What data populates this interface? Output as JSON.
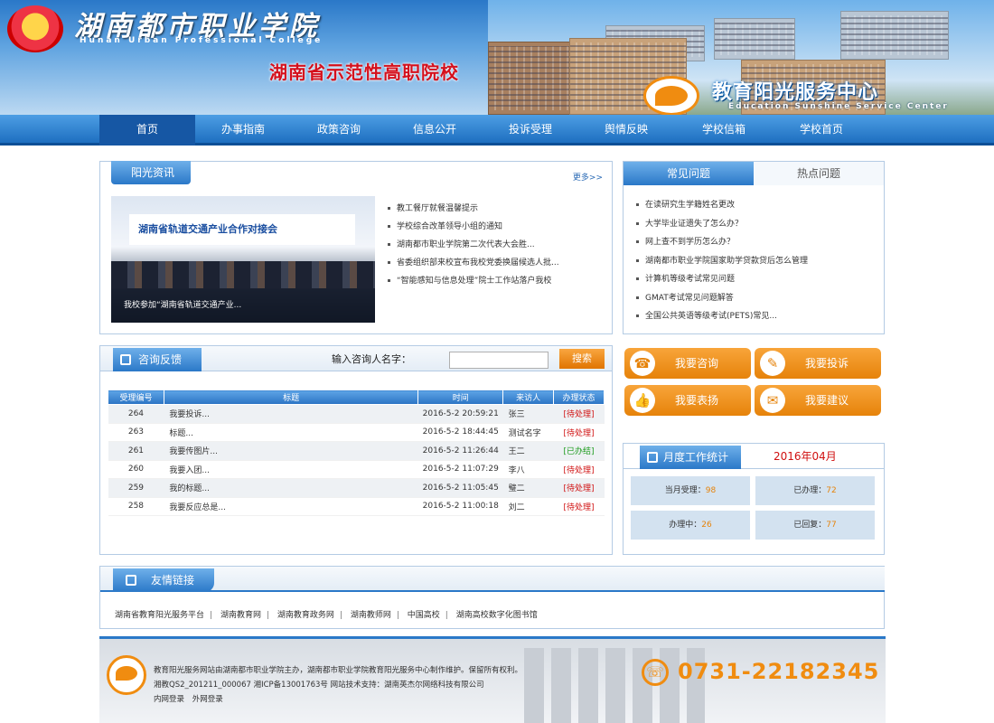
{
  "header": {
    "school_name": "湖南都市职业学院",
    "school_name_en": "Hunan Urban Professional College",
    "slogan": "湖南省示范性高职院校",
    "center_name": "教育阳光服务中心",
    "center_name_en": "Education Sunshine Service Center"
  },
  "nav": {
    "items": [
      "首页",
      "办事指南",
      "政策咨询",
      "信息公开",
      "投诉受理",
      "舆情反映",
      "学校信箱",
      "学校首页"
    ],
    "active_index": 0
  },
  "news": {
    "title": "阳光资讯",
    "more": "更多>>",
    "image_banner": "湖南省轨道交通产业合作对接会",
    "image_caption": "我校参加“湖南省轨道交通产业...",
    "items": [
      "教工餐厅就餐温馨提示",
      "学校综合改革领导小组的通知",
      "湖南都市职业学院第二次代表大会胜...",
      "省委组织部来校宣布我校党委换届候选人批...",
      "“智能感知与信息处理”院士工作站落户我校"
    ]
  },
  "faq": {
    "tabs": [
      "常见问题",
      "热点问题"
    ],
    "items": [
      "在读研究生学籍姓名更改",
      "大学毕业证遗失了怎么办？",
      "网上查不到学历怎么办？",
      "湖南都市职业学院国家助学贷款贷后怎么管理",
      "计算机等级考试常见问题",
      "GMAT考试常见问题解答",
      "全国公共英语等级考试(PETS)常见..."
    ]
  },
  "consult": {
    "title": "咨询反馈",
    "search_label": "输入咨询人名字：",
    "search_value": "",
    "search_button": "搜索",
    "columns": [
      "受理编号",
      "标题",
      "时间",
      "来访人",
      "办理状态"
    ],
    "rows": [
      {
        "id": "264",
        "title": "我要投诉...",
        "time": "2016-5-2 20:59:21",
        "person": "张三",
        "status": "[待处理]",
        "done": false
      },
      {
        "id": "263",
        "title": "标题...",
        "time": "2016-5-2 18:44:45",
        "person": "测试名字",
        "status": "[待处理]",
        "done": false
      },
      {
        "id": "261",
        "title": "我要传图片...",
        "time": "2016-5-2 11:26:44",
        "person": "王二",
        "status": "[已办结]",
        "done": true
      },
      {
        "id": "260",
        "title": "我要入团...",
        "time": "2016-5-2 11:07:29",
        "person": "李八",
        "status": "[待处理]",
        "done": false
      },
      {
        "id": "259",
        "title": "我的标题...",
        "time": "2016-5-2 11:05:45",
        "person": "璧二",
        "status": "[待处理]",
        "done": false
      },
      {
        "id": "258",
        "title": "我要反应总是...",
        "time": "2016-5-2 11:00:18",
        "person": "刘二",
        "status": "[待处理]",
        "done": false
      }
    ]
  },
  "actions": [
    {
      "label": "我要咨询",
      "icon": "headset-icon",
      "glyph": "☎"
    },
    {
      "label": "我要投诉",
      "icon": "pencil-icon",
      "glyph": "✎"
    },
    {
      "label": "我要表扬",
      "icon": "thumbs-up-icon",
      "glyph": "👍"
    },
    {
      "label": "我要建议",
      "icon": "document-icon",
      "glyph": "✉"
    }
  ],
  "stats": {
    "title": "月度工作统计",
    "month": "2016年04月",
    "cells": [
      {
        "label": "当月受理：",
        "value": "98"
      },
      {
        "label": "已办理：",
        "value": "72"
      },
      {
        "label": "办理中：",
        "value": "26"
      },
      {
        "label": "已回复：",
        "value": "77"
      }
    ]
  },
  "links": {
    "title": "友情链接",
    "items": [
      "湖南省教育阳光服务平台",
      "湖南教育网",
      "湖南教育政务网",
      "湖南教师网",
      "中国高校",
      "湖南高校数字化图书馆"
    ]
  },
  "footer": {
    "line1": "教育阳光服务网站由湖南都市职业学院主办，湖南都市职业学院教育阳光服务中心制作维护。保留所有权利。",
    "line2": "湘教QS2_201211_000067 湘ICP备13001763号 网站技术支持：湖南英杰尔网络科技有限公司",
    "login_links": [
      "内网登录",
      "外网登录"
    ],
    "phone": "0731-22182345"
  },
  "colors": {
    "primary": "#2a78c8",
    "accent": "#e6830a",
    "alert": "#d01010",
    "ok": "#1a9a1a"
  }
}
